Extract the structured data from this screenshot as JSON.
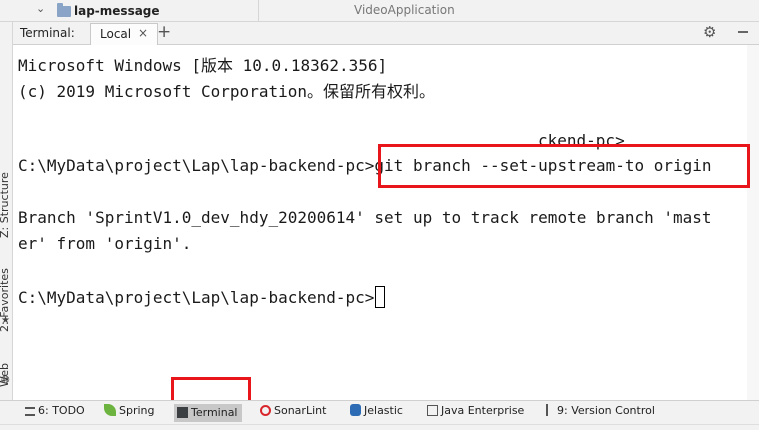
{
  "top": {
    "project_name": "lap-message",
    "window_title": "VideoApplication"
  },
  "left_toolbar": {
    "structure": "Z: Structure",
    "favorites": "2: Favorites",
    "web": "Web"
  },
  "terminal_header": {
    "label": "Terminal:",
    "tab_name": "Local",
    "close_glyph": "×",
    "add_glyph": "+",
    "settings_icon": "gear-icon",
    "hide_icon": "minimize-icon"
  },
  "terminal": {
    "lines": [
      "Microsoft Windows [版本 10.0.18362.356]",
      "(c) 2019 Microsoft Corporation。保留所有权利。",
      "ckend-pc>",
      "C:\\MyData\\project\\Lap\\lap-backend-pc>git branch --set-upstream-to origin",
      "Branch 'SprintV1.0_dev_hdy_20200614' set up to track remote branch 'mast",
      "er' from 'origin'.",
      "C:\\MyData\\project\\Lap\\lap-backend-pc>"
    ]
  },
  "bottom_tabs": [
    {
      "label": "6: TODO",
      "icon": "todo-list-icon"
    },
    {
      "label": "Spring",
      "icon": "spring-leaf-icon"
    },
    {
      "label": "Terminal",
      "icon": "terminal-icon"
    },
    {
      "label": "SonarLint",
      "icon": "sonarlint-icon"
    },
    {
      "label": "Jelastic",
      "icon": "jelastic-icon"
    },
    {
      "label": "Java Enterprise",
      "icon": "java-enterprise-icon"
    },
    {
      "label": "9: Version Control",
      "icon": "version-control-icon"
    }
  ],
  "annotation_color": "#e8161b"
}
